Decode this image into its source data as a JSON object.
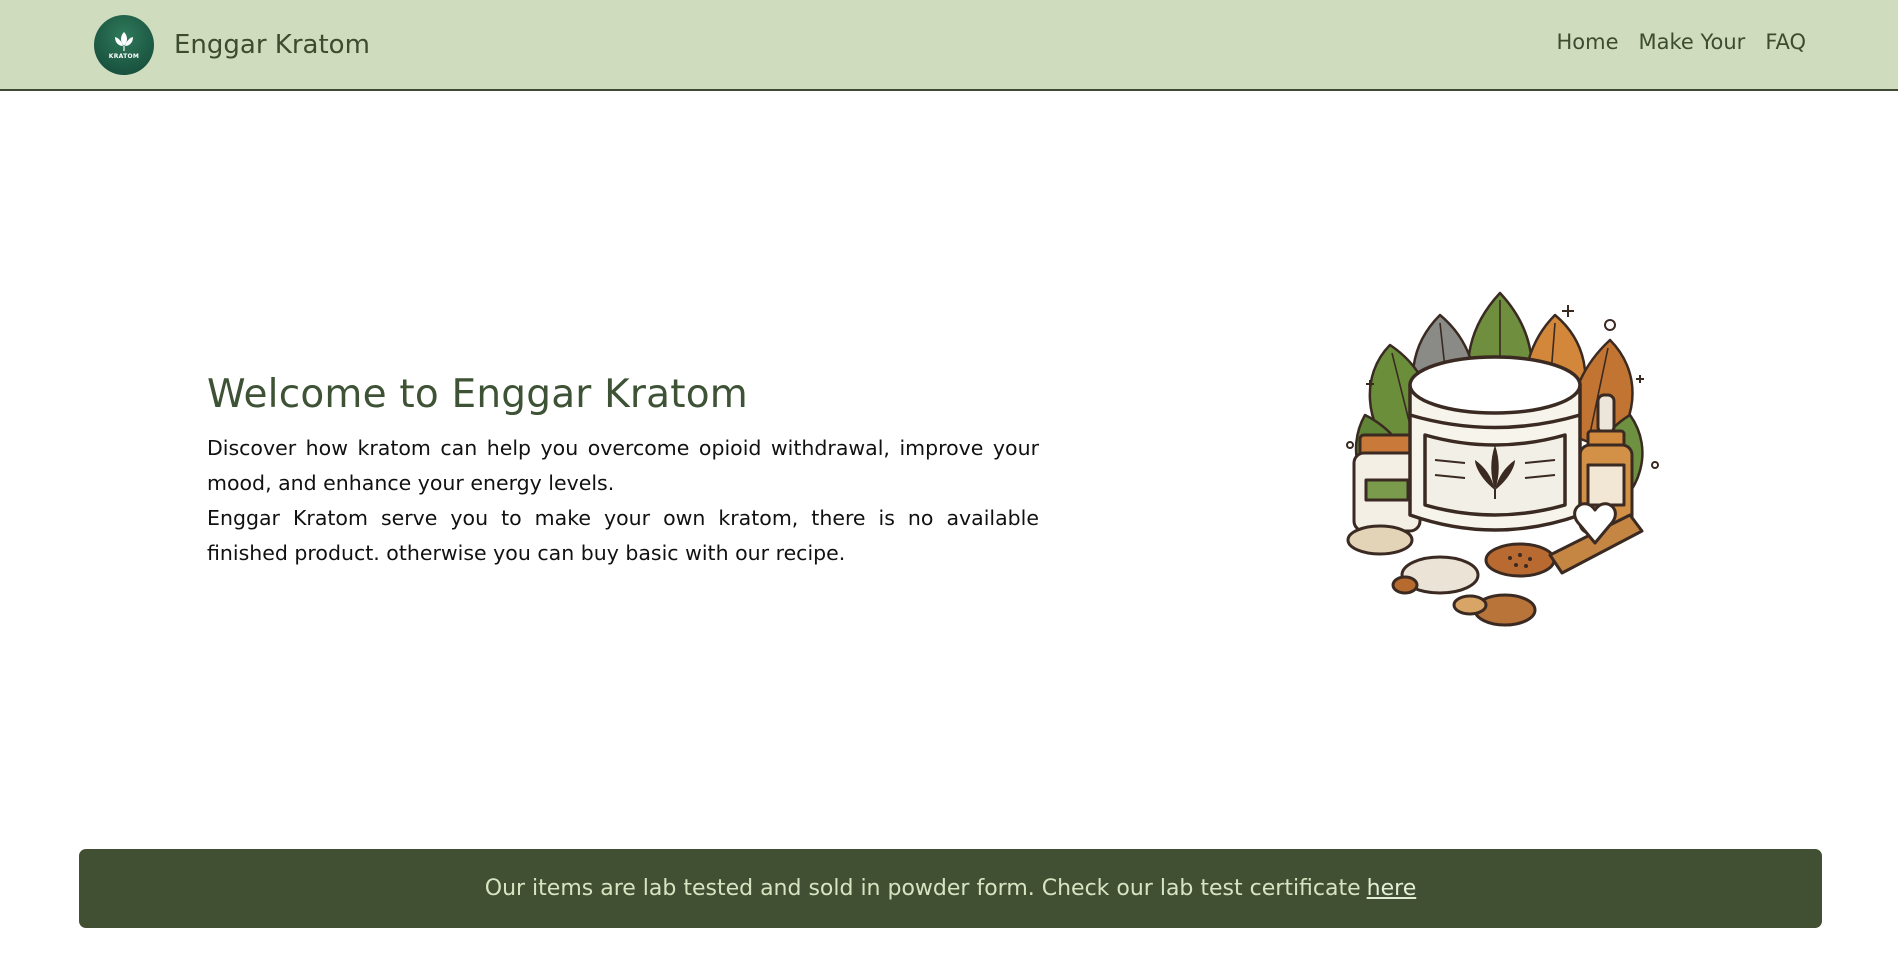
{
  "navbar": {
    "brand_name": "Enggar Kratom",
    "logo_text": "KRATOM",
    "links": [
      {
        "label": "Home"
      },
      {
        "label": "Make Your"
      },
      {
        "label": "FAQ"
      }
    ]
  },
  "hero": {
    "title": "Welcome to Enggar Kratom",
    "paragraph_1": "Discover how kratom can help you overcome opioid withdrawal, improve your mood, and enhance your energy levels.",
    "paragraph_2": "Enggar Kratom serve you to make your own kratom, there is no available finished product. otherwise you can buy basic with our recipe."
  },
  "illustration": {
    "icon": "kratom-products-illustration"
  },
  "banner": {
    "text": "Our items are lab tested and sold in powder form. Check our lab test certificate",
    "link_label": "here"
  },
  "colors": {
    "navbar_bg": "#cfdcbd",
    "brand_text": "#3c4c30",
    "banner_bg": "#414f33",
    "banner_text": "#d6e4c2",
    "title_color": "#3e5235"
  }
}
